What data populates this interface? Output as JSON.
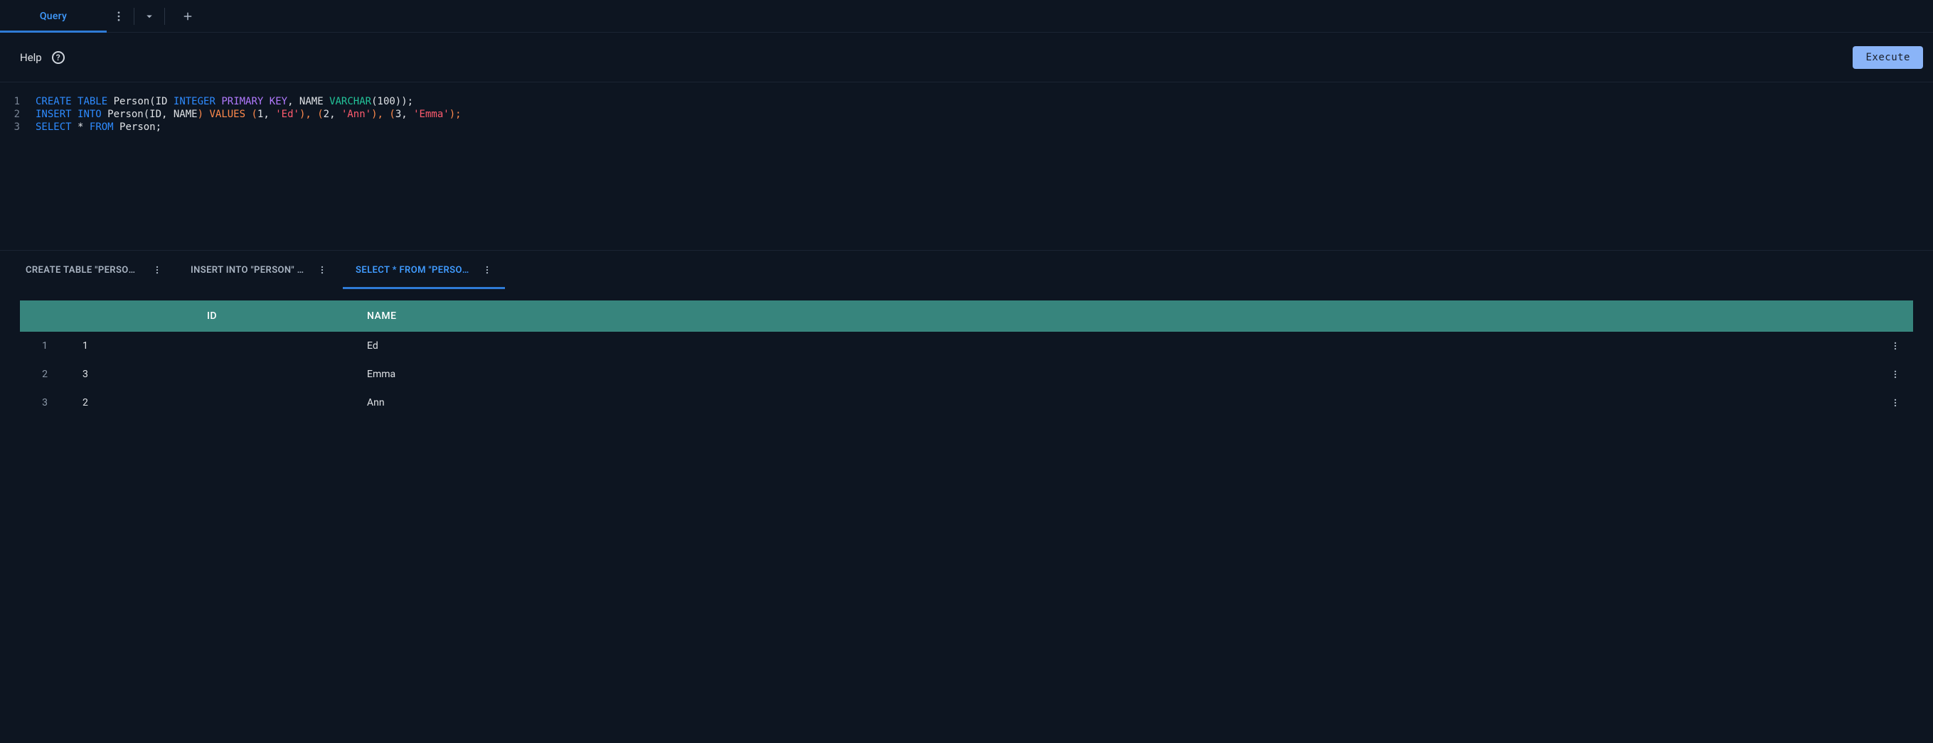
{
  "top_tabs": {
    "query_label": "Query"
  },
  "toolbar": {
    "help_label": "Help",
    "help_icon_glyph": "?",
    "execute_label": "Execute"
  },
  "editor": {
    "lines": [
      "1",
      "2",
      "3"
    ],
    "code": {
      "l1": {
        "create": "CREATE",
        "table": "TABLE",
        "person_open": " Person(ID ",
        "integer": "INTEGER",
        "space1": " ",
        "primary_key": "PRIMARY KEY",
        "comma_name": ", NAME ",
        "varchar": "VARCHAR",
        "tail": "(100));"
      },
      "l2": {
        "insert": "INSERT",
        "space1": " ",
        "into": "INTO",
        "person_cols": " Person(ID, NAME",
        "close_paren": ")",
        "space2": " ",
        "values": "VALUES",
        "space3": " ",
        "open1": "(",
        "v1": "1, ",
        "s1": "'Ed'",
        "sep1": "), (",
        "v2": "2, ",
        "s2": "'Ann'",
        "sep2": "), (",
        "v3": "3, ",
        "s3": "'Emma'",
        "tail": ");"
      },
      "l3": {
        "select": "SELECT",
        "space1": " ",
        "star": "*",
        "space2": " ",
        "from": "FROM",
        "person": " Person;"
      }
    }
  },
  "result_tabs": [
    {
      "label": "CREATE TABLE \"PERSON\" (…",
      "active": false
    },
    {
      "label": "INSERT INTO \"PERSON\" (\"I…",
      "active": false
    },
    {
      "label": "SELECT * FROM \"PERSON\"",
      "active": true
    }
  ],
  "result_table": {
    "columns": [
      "ID",
      "NAME"
    ],
    "rows": [
      {
        "n": "1",
        "id": "1",
        "name": "Ed"
      },
      {
        "n": "2",
        "id": "3",
        "name": "Emma"
      },
      {
        "n": "3",
        "id": "2",
        "name": "Ann"
      }
    ]
  },
  "chart_data": {
    "type": "table",
    "columns": [
      "ID",
      "NAME"
    ],
    "rows": [
      [
        1,
        "Ed"
      ],
      [
        3,
        "Emma"
      ],
      [
        2,
        "Ann"
      ]
    ]
  }
}
